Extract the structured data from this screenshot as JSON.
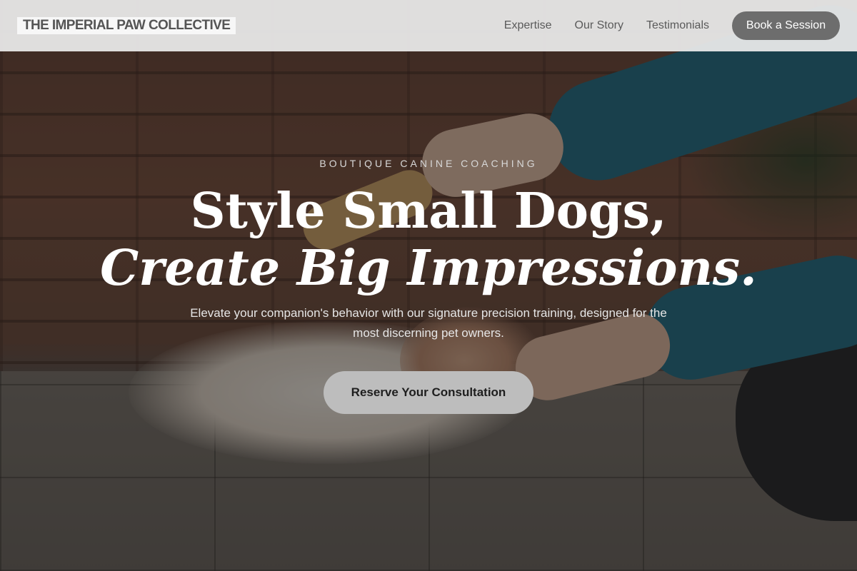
{
  "header": {
    "logo": "THE IMPERIAL PAW COLLECTIVE",
    "nav": [
      {
        "label": "Expertise"
      },
      {
        "label": "Our Story"
      },
      {
        "label": "Testimonials"
      }
    ],
    "book_button": "Book a Session"
  },
  "hero": {
    "eyebrow": "BOUTIQUE CANINE COACHING",
    "headline_line1": "Style Small Dogs,",
    "headline_line2": "Create Big Impressions.",
    "subtext": "Elevate your companion's behavior with our signature precision training, designed for the most discerning pet owners.",
    "cta": "Reserve Your Consultation"
  },
  "colors": {
    "header_bg": "#ececec",
    "book_button_bg": "#6d6d6d",
    "cta_bg": "#bdbdbd",
    "headline": "#ffffff"
  }
}
